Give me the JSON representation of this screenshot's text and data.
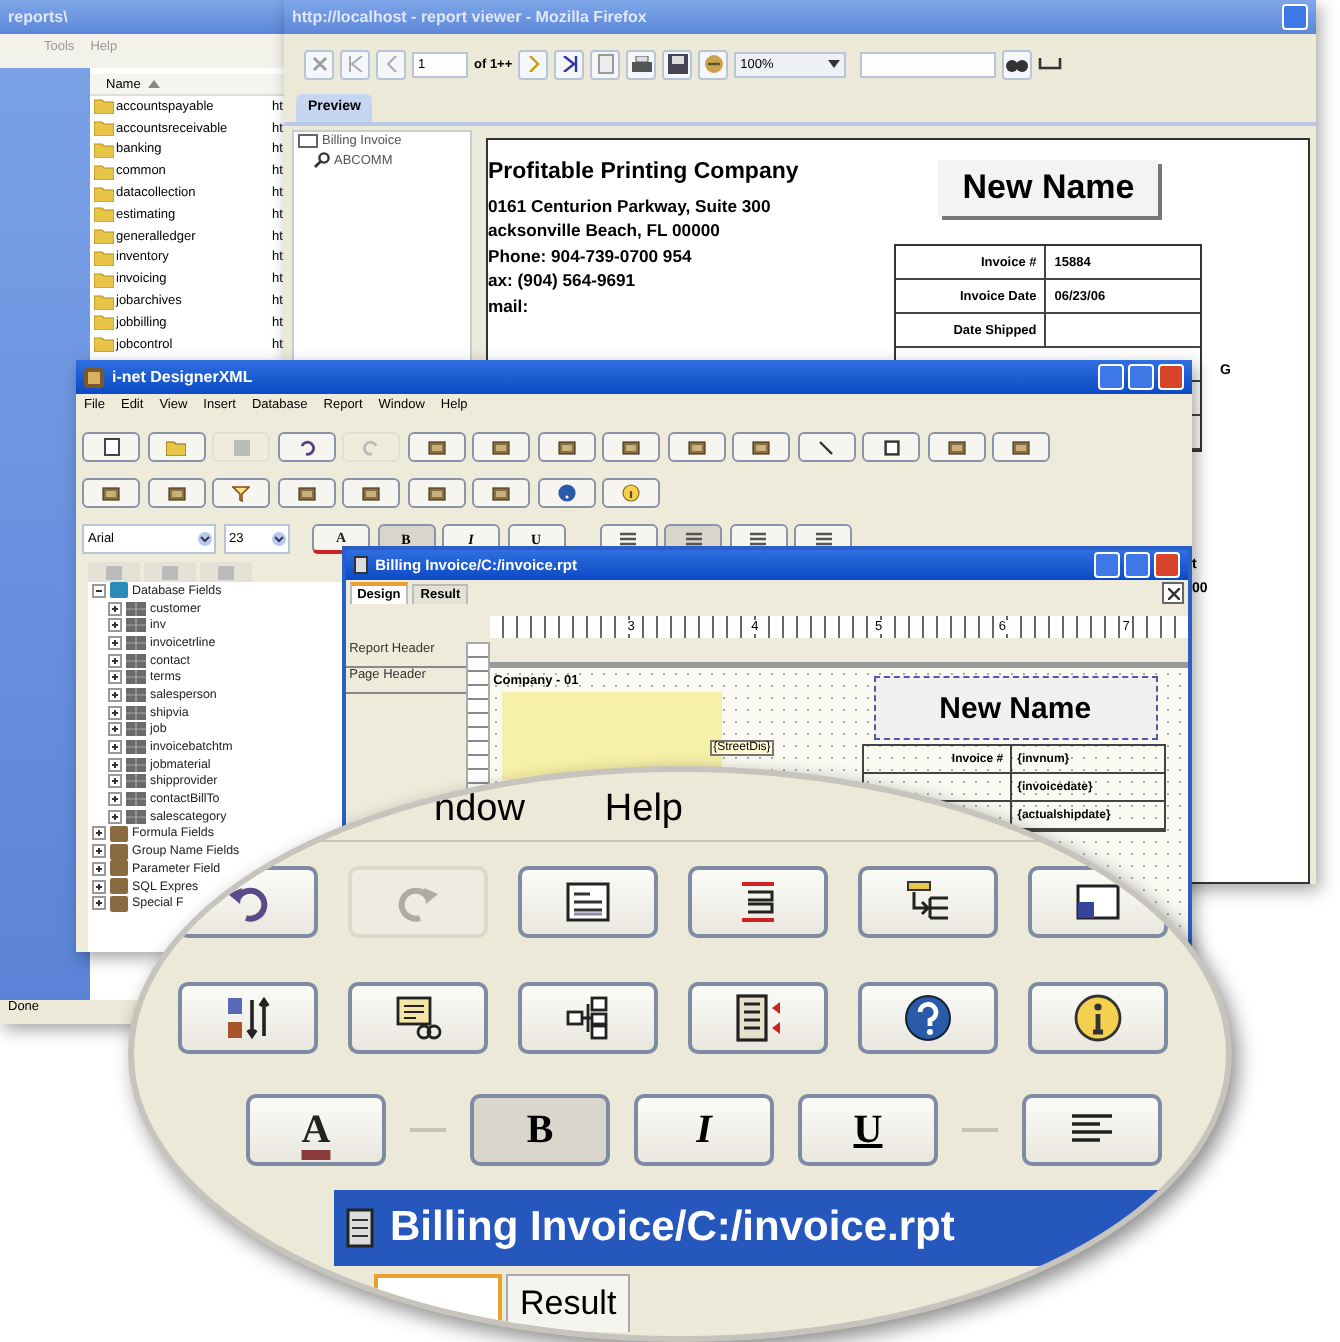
{
  "explorer": {
    "title": "reports\\",
    "menu": [
      "Tools",
      "Help"
    ],
    "column_header": "Name",
    "folders": [
      {
        "name": "accountspayable",
        "column_2": "ht"
      },
      {
        "name": "accountsreceivable",
        "column_2": "ht"
      },
      {
        "name": "banking",
        "column_2": "ht"
      },
      {
        "name": "common",
        "column_2": "ht"
      },
      {
        "name": "datacollection",
        "column_2": "ht"
      },
      {
        "name": "estimating",
        "column_2": "ht"
      },
      {
        "name": "generalledger",
        "column_2": "ht"
      },
      {
        "name": "inventory",
        "column_2": "ht"
      },
      {
        "name": "invoicing",
        "column_2": "ht"
      },
      {
        "name": "jobarchives",
        "column_2": "ht"
      },
      {
        "name": "jobbilling",
        "column_2": "ht"
      },
      {
        "name": "jobcontrol",
        "column_2": "ht"
      }
    ],
    "status": "Done"
  },
  "viewer": {
    "title": "http://localhost - report viewer - Mozilla Firefox",
    "page_field": "1",
    "page_count": "of 1++",
    "zoom": "100%",
    "tabs": [
      {
        "label": "Preview",
        "selected": true
      }
    ],
    "tree": [
      {
        "label": "Billing Invoice",
        "children": [
          {
            "label": "ABCOMM"
          }
        ]
      }
    ],
    "company_lines": [
      "Profitable Printing Company",
      "0161 Centurion Parkway, Suite 300",
      "acksonville Beach, FL  00000",
      "Phone: 904-739-0700 954",
      "ax: (904) 564-9691",
      "mail:"
    ],
    "banner": "New Name",
    "invoice_rows": [
      {
        "label": "Invoice #",
        "value": "15884"
      },
      {
        "label": "Invoice Date",
        "value": "06/23/06"
      },
      {
        "label": "Date Shipped"
      }
    ],
    "column_fragments": [
      "G",
      "t",
      "00"
    ]
  },
  "designer": {
    "title": "i-net DesignerXML",
    "menu": [
      "File",
      "Edit",
      "View",
      "Insert",
      "Database",
      "Report",
      "Window",
      "Help"
    ],
    "toolbar_rows": [
      [
        {
          "kind": "new",
          "disabled": false
        },
        {
          "kind": "open",
          "disabled": false
        },
        {
          "kind": "save",
          "disabled": true
        },
        {
          "kind": "undo",
          "disabled": false
        },
        {
          "kind": "redo",
          "disabled": true
        },
        {
          "kind": "tool",
          "disabled": false
        },
        {
          "kind": "tool",
          "disabled": false
        },
        {
          "kind": "tool",
          "disabled": false
        },
        {
          "kind": "tool",
          "disabled": false
        },
        {
          "kind": "tool",
          "disabled": false
        },
        {
          "kind": "tool",
          "disabled": false
        },
        {
          "kind": "line",
          "disabled": false
        },
        {
          "kind": "frame",
          "disabled": false
        },
        {
          "kind": "tool",
          "disabled": false
        },
        {
          "kind": "tool",
          "disabled": false
        }
      ],
      [
        {
          "kind": "tool",
          "disabled": false
        },
        {
          "kind": "tool",
          "disabled": false
        },
        {
          "kind": "filter",
          "disabled": false
        },
        {
          "kind": "tool",
          "disabled": false
        },
        {
          "kind": "tool",
          "disabled": false
        },
        {
          "kind": "tool",
          "disabled": false
        },
        {
          "kind": "tool",
          "disabled": false
        },
        {
          "kind": "help",
          "disabled": false
        },
        {
          "kind": "info",
          "disabled": false
        }
      ]
    ],
    "font": "Arial",
    "size": "23",
    "format_buttons": [
      {
        "kind": "color",
        "label": "A",
        "selected": false
      },
      {
        "kind": "bold",
        "label": "B",
        "selected": true
      },
      {
        "kind": "italic",
        "label": "I",
        "selected": false
      },
      {
        "kind": "underline",
        "label": "U",
        "selected": false
      }
    ],
    "align_buttons": [
      {
        "selected": false
      },
      {
        "selected": true
      },
      {
        "selected": false
      },
      {
        "selected": false
      }
    ],
    "tree": [
      {
        "label": "Database Fields",
        "expanded": true,
        "children": [
          {
            "label": "customer"
          },
          {
            "label": "inv"
          },
          {
            "label": "invoicetrline"
          },
          {
            "label": "contact"
          },
          {
            "label": "terms"
          },
          {
            "label": "salesperson"
          },
          {
            "label": "shipvia"
          },
          {
            "label": "job"
          },
          {
            "label": "invoicebatchtm"
          },
          {
            "label": "jobmaterial"
          },
          {
            "label": "shipprovider"
          },
          {
            "label": "contactBillTo"
          },
          {
            "label": "salescategory"
          }
        ]
      },
      {
        "label": "Formula Fields",
        "expanded": false
      },
      {
        "label": "Group Name Fields",
        "expanded": false
      },
      {
        "label": "Parameter Field",
        "expanded": false
      },
      {
        "label": "SQL Expres",
        "expanded": false
      },
      {
        "label": "Special F",
        "expanded": false
      }
    ],
    "document": {
      "title": "Billing Invoice/C:/invoice.rpt",
      "tabs": [
        {
          "label": "Design",
          "selected": true
        },
        {
          "label": "Result",
          "selected": false
        }
      ],
      "sections": [
        "Report Header",
        "Page Header"
      ],
      "ruler": [
        "3",
        "4",
        "5",
        "6",
        "7"
      ],
      "company_field": "Company - 01",
      "street_field": "{StreetDis}",
      "banner": "New Name",
      "fields": [
        {
          "label": "Invoice #",
          "value": "{invnum}"
        },
        {
          "value": "{invoicedate}"
        },
        {
          "value": "{actualshipdate}"
        }
      ]
    }
  },
  "magnifier": {
    "menu": [
      "ndow",
      "Help"
    ],
    "rows": [
      [
        {
          "kind": "undo",
          "disabled": false
        },
        {
          "kind": "redo",
          "disabled": true
        },
        {
          "kind": "text-box",
          "disabled": false
        },
        {
          "kind": "align",
          "disabled": false
        },
        {
          "kind": "tree",
          "disabled": false
        },
        {
          "kind": "table",
          "disabled": false
        }
      ],
      [
        {
          "kind": "sort",
          "disabled": false
        },
        {
          "kind": "linked",
          "disabled": false
        },
        {
          "kind": "hierarchy",
          "disabled": false
        },
        {
          "kind": "columns",
          "disabled": false
        },
        {
          "kind": "help",
          "disabled": false
        },
        {
          "kind": "info",
          "disabled": false
        }
      ]
    ],
    "format_buttons": [
      {
        "kind": "color",
        "label": "A",
        "selected": false
      },
      {
        "kind": "bold",
        "label": "B",
        "selected": true
      },
      {
        "kind": "italic",
        "label": "I",
        "selected": false
      },
      {
        "kind": "underline",
        "label": "U",
        "selected": false
      },
      {
        "kind": "align",
        "selected": false
      }
    ],
    "title": "Billing Invoice/C:/invoice.rpt",
    "tab": "Result"
  }
}
